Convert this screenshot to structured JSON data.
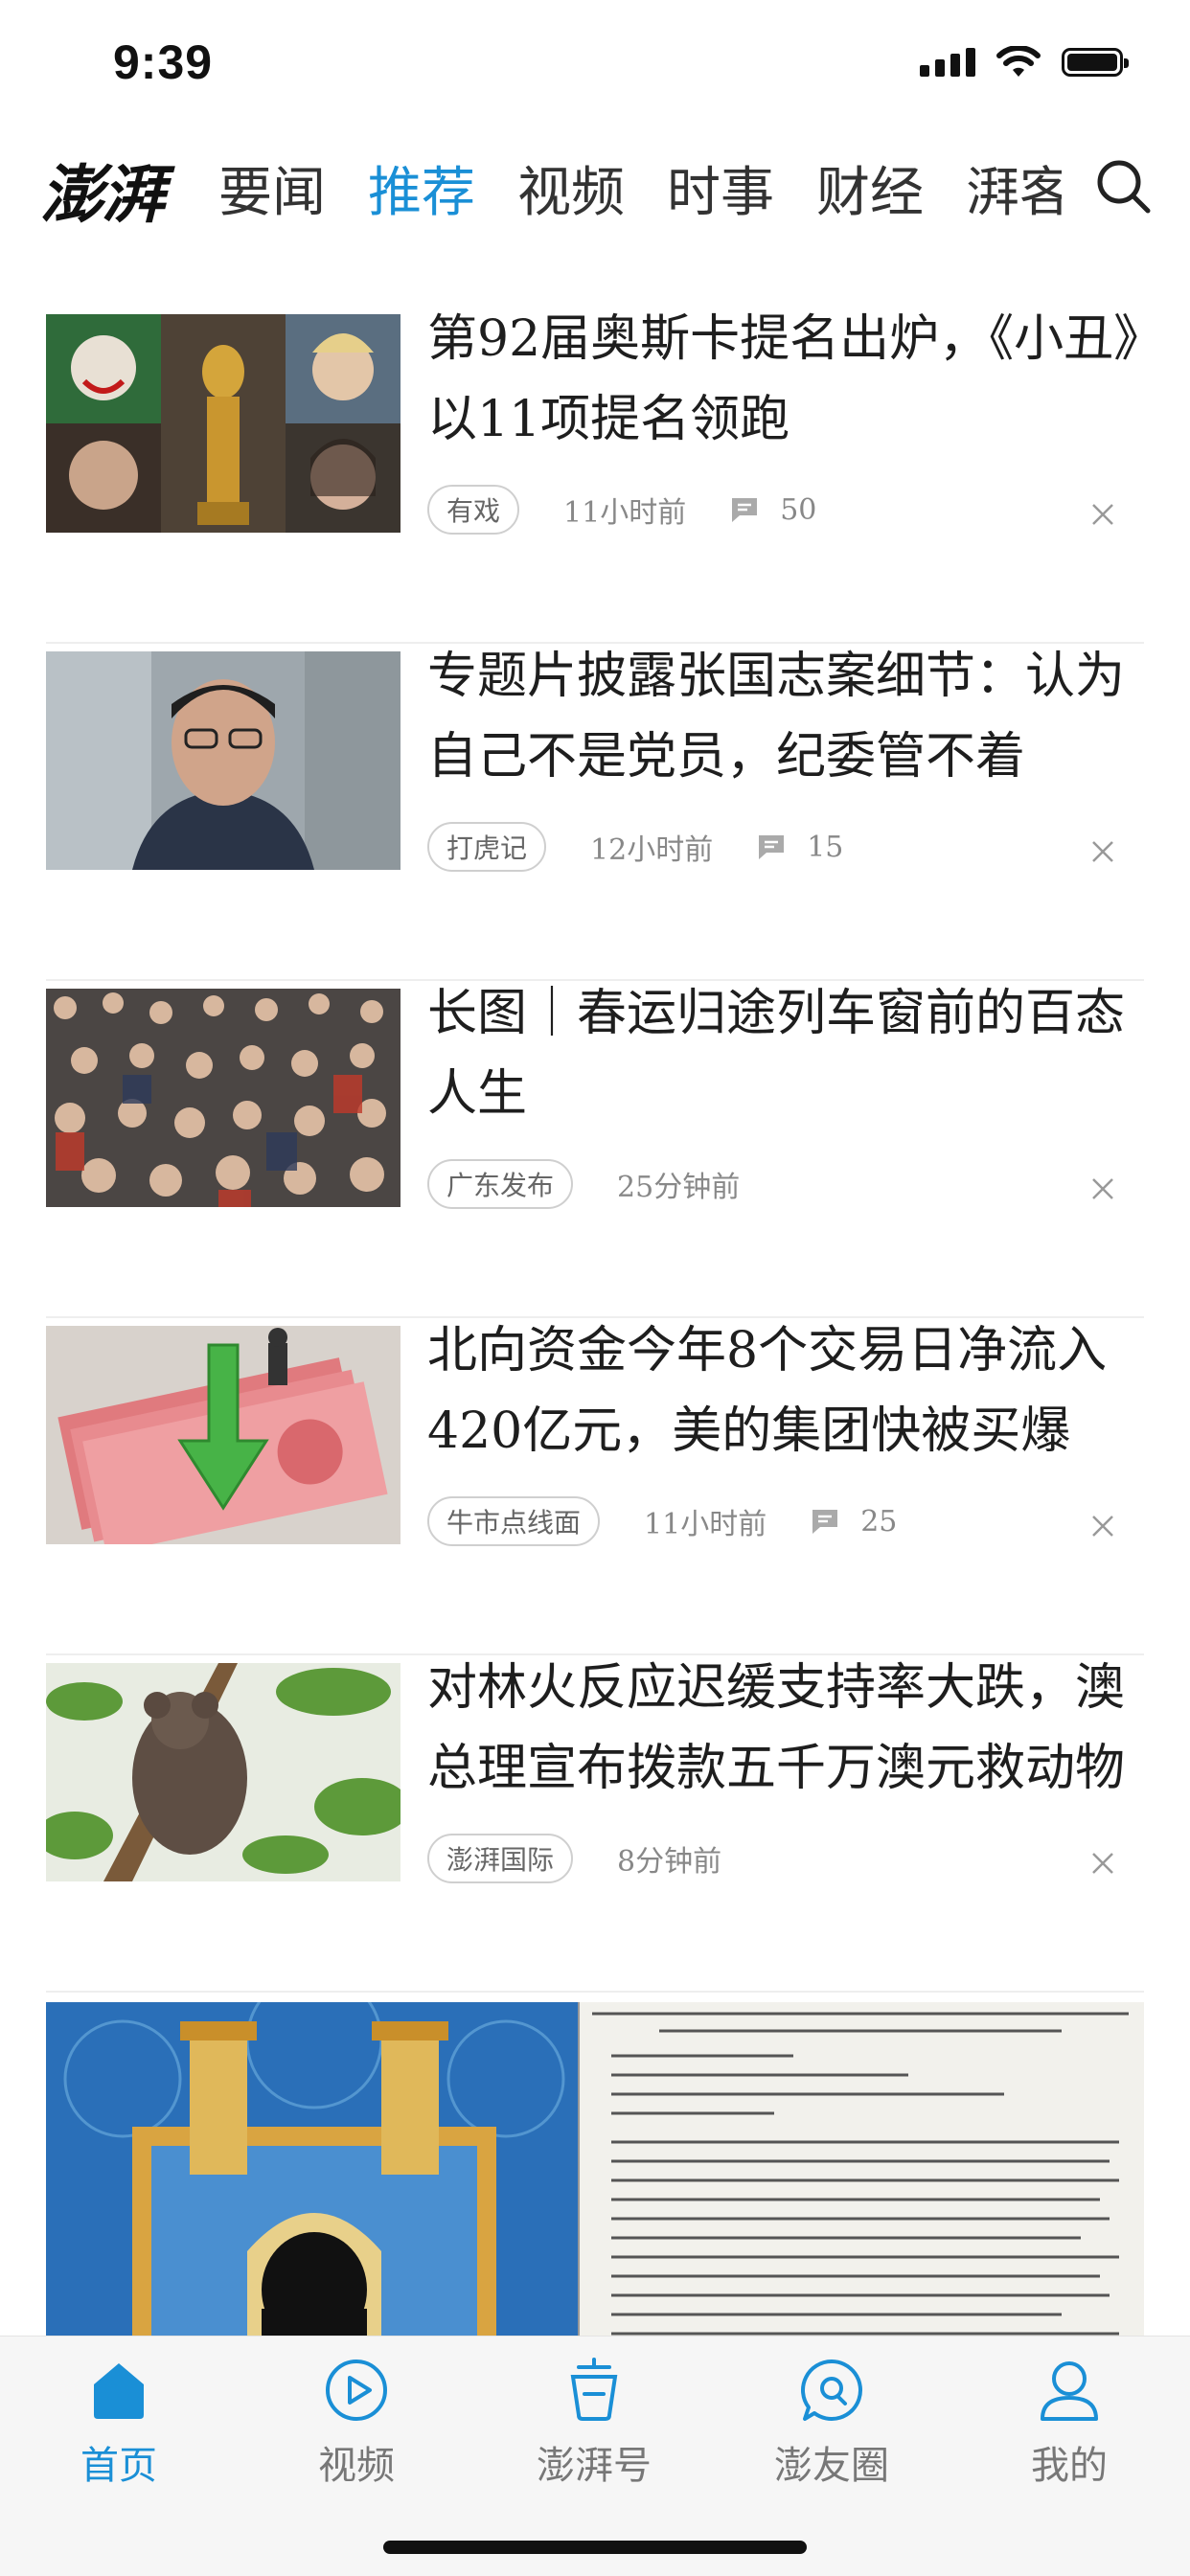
{
  "status_bar": {
    "time": "9:39"
  },
  "header": {
    "logo": "澎湃",
    "tabs": [
      {
        "label": "要闻",
        "active": false
      },
      {
        "label": "推荐",
        "active": true
      },
      {
        "label": "视频",
        "active": false
      },
      {
        "label": "时事",
        "active": false
      },
      {
        "label": "财经",
        "active": false
      },
      {
        "label": "湃客",
        "active": false
      }
    ],
    "search_icon": "search-icon"
  },
  "feed": [
    {
      "title": "第92届奥斯卡提名出炉，《小丑》以11项提名领跑",
      "tag": "有戏",
      "time": "11小时前",
      "comments": "50"
    },
    {
      "title": "专题片披露张国志案细节：认为自己不是党员，纪委管不着",
      "tag": "打虎记",
      "time": "12小时前",
      "comments": "15"
    },
    {
      "title": "长图｜春运归途列车窗前的百态人生",
      "tag": "广东发布",
      "time": "25分钟前",
      "comments": null
    },
    {
      "title": "北向资金今年8个交易日净流入420亿元，美的集团快被买爆",
      "tag": "牛市点线面",
      "time": "11小时前",
      "comments": "25"
    },
    {
      "title": "对林火反应迟缓支持率大跌，澳总理宣布拨款五千万澳元救动物",
      "tag": "澎湃国际",
      "time": "8分钟前",
      "comments": null
    }
  ],
  "tabbar": [
    {
      "label": "首页",
      "icon": "home-icon",
      "active": true
    },
    {
      "label": "视频",
      "icon": "play-icon",
      "active": false
    },
    {
      "label": "澎湃号",
      "icon": "cup-icon",
      "active": false
    },
    {
      "label": "澎友圈",
      "icon": "chat-icon",
      "active": false
    },
    {
      "label": "我的",
      "icon": "person-icon",
      "active": false
    }
  ],
  "colors": {
    "accent": "#1a8fd6",
    "text": "#1e1e1e",
    "meta": "#888888"
  }
}
